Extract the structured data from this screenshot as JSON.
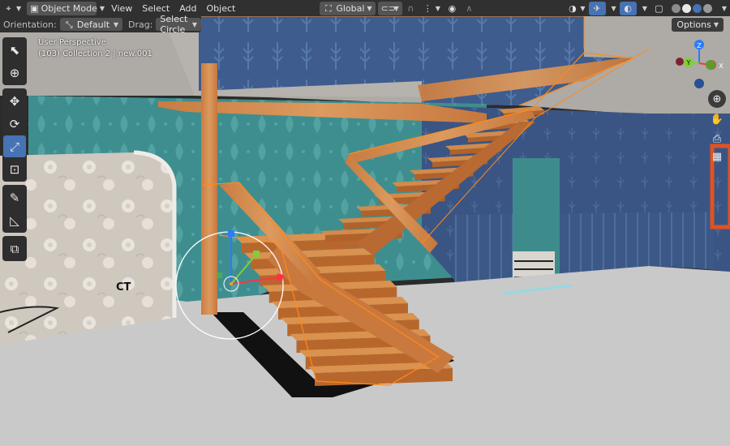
{
  "header": {
    "mode_label": "Object Mode",
    "menus": [
      "View",
      "Select",
      "Add",
      "Object"
    ],
    "transform_orientation": "Global",
    "shading_colors": [
      "#8c8c8c",
      "#e8e8e8",
      "#4772b3",
      "#9a9a9a"
    ]
  },
  "tool_settings": {
    "orientation_label": "Orientation:",
    "orientation_value": "Default",
    "drag_label": "Drag:",
    "drag_value": "Select Circle",
    "options_label": "Options"
  },
  "viewport": {
    "perspective": "User Perspective",
    "collection": "(103) Collection 2 | new.001",
    "floor_text": "CT"
  },
  "gizmo": {
    "z": "Z",
    "y": "Y",
    "x": "X"
  },
  "tools": [
    {
      "name": "select-box-tool",
      "icon": "cursor-arrow"
    },
    {
      "name": "cursor-tool",
      "icon": "crosshair"
    },
    {
      "name": "move-tool",
      "icon": "move-arrows"
    },
    {
      "name": "rotate-tool",
      "icon": "rotate"
    },
    {
      "name": "scale-tool",
      "icon": "scale",
      "active": true
    },
    {
      "name": "transform-tool",
      "icon": "transform"
    },
    {
      "name": "annotate-tool",
      "icon": "pencil"
    },
    {
      "name": "measure-tool",
      "icon": "ruler"
    },
    {
      "name": "add-cube-tool",
      "icon": "cube-plus"
    }
  ],
  "colors": {
    "accent": "#4772b3",
    "selection_outline": "#ff8a1a",
    "wood": "#d18a4e"
  }
}
